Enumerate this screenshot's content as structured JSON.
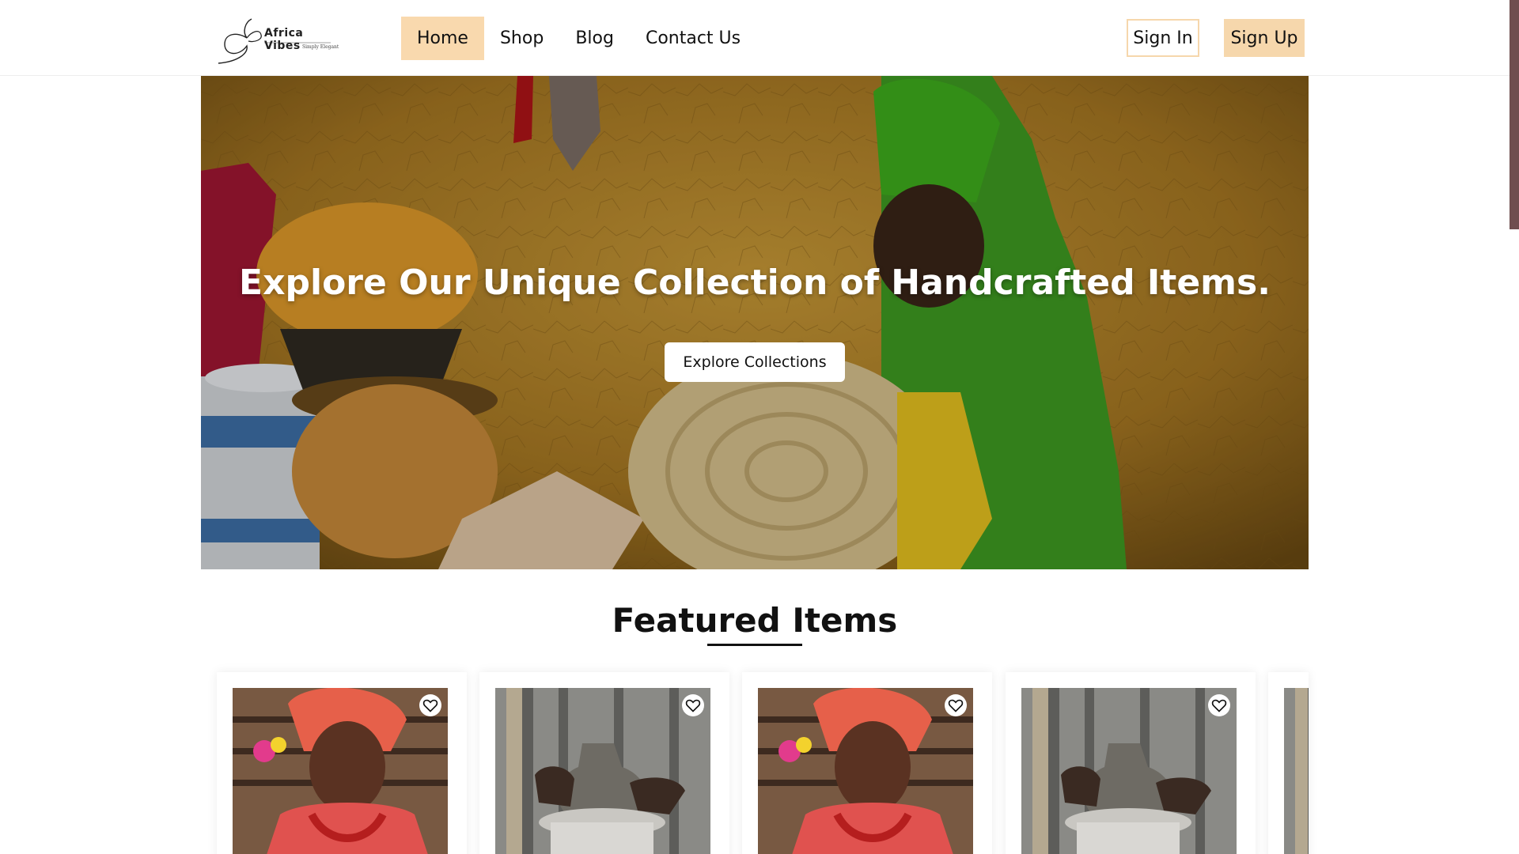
{
  "brand": {
    "name": "Africa Vibes",
    "tagline": "Simply Elegant"
  },
  "nav": {
    "links": [
      {
        "label": "Home",
        "active": true
      },
      {
        "label": "Shop",
        "active": false
      },
      {
        "label": "Blog",
        "active": false
      },
      {
        "label": "Contact Us",
        "active": false
      }
    ],
    "sign_in": "Sign In",
    "sign_up": "Sign Up"
  },
  "hero": {
    "title": "Explore Our Unique Collection of Handcrafted Items.",
    "cta": "Explore Collections"
  },
  "featured": {
    "title": "Featured Items",
    "items": [
      {
        "image": "woman-in-red-gele"
      },
      {
        "image": "pottery-wheel"
      },
      {
        "image": "woman-in-red-gele"
      },
      {
        "image": "pottery-wheel"
      },
      {
        "image": "pottery-wheel"
      }
    ]
  },
  "colors": {
    "accent": "#f9d9ae",
    "scrollbar": "#6f4e4f"
  },
  "icons": {
    "favorite": "heart-outline-icon",
    "logo": "butterfly-logo-icon"
  }
}
